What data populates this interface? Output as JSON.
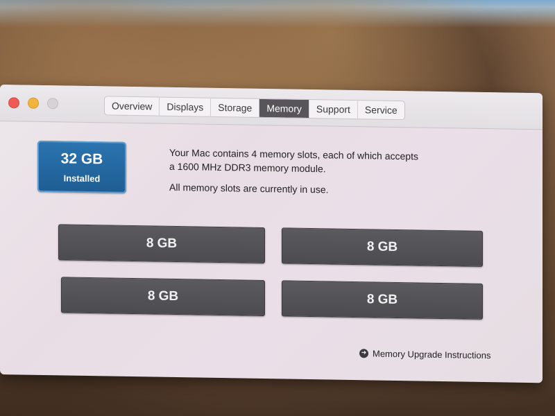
{
  "tabs": [
    {
      "label": "Overview"
    },
    {
      "label": "Displays"
    },
    {
      "label": "Storage"
    },
    {
      "label": "Memory"
    },
    {
      "label": "Support"
    },
    {
      "label": "Service"
    }
  ],
  "active_tab": "Memory",
  "memory": {
    "total": "32 GB",
    "total_label": "Installed",
    "description_line1": "Your Mac contains 4 memory slots, each of which accepts",
    "description_line2": "a 1600 MHz DDR3 memory module.",
    "status": "All memory slots are currently in use.",
    "slots": [
      {
        "size": "8 GB"
      },
      {
        "size": "8 GB"
      },
      {
        "size": "8 GB"
      },
      {
        "size": "8 GB"
      }
    ]
  },
  "upgrade_link": {
    "label": "Memory Upgrade Instructions",
    "icon": "arrow-circle-icon"
  },
  "colors": {
    "badge": "#2169a5",
    "active_tab": "#575559",
    "slot": "#545357",
    "close": "#ee5b52",
    "minimize": "#f2b33a"
  }
}
